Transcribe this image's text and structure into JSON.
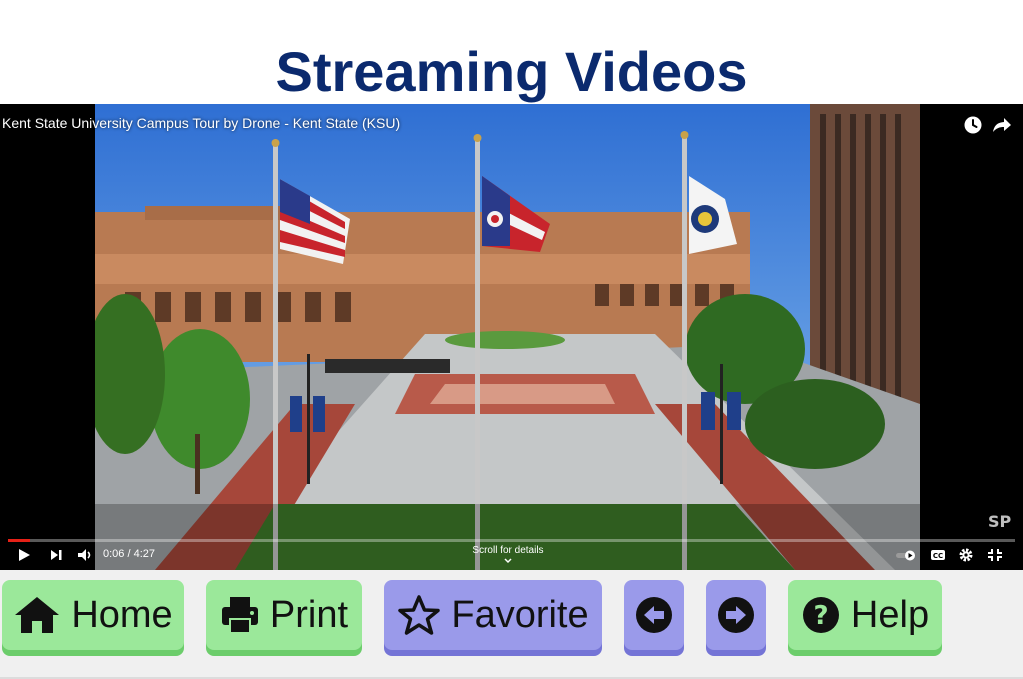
{
  "page": {
    "title": "Streaming Videos"
  },
  "video": {
    "title": "Kent State University Campus Tour by Drone - Kent State (KSU)",
    "current_time": "0:06",
    "duration": "4:27",
    "time_display": "0:06 / 4:27",
    "progress": 0.022,
    "scroll_hint": "Scroll for details",
    "watermark": "SP",
    "icons": [
      "watch-later-icon",
      "share-icon",
      "play-icon",
      "next-icon",
      "volume-icon",
      "autoplay-toggle-icon",
      "captions-icon",
      "settings-icon",
      "exit-fullscreen-icon"
    ]
  },
  "toolbar": {
    "home": "Home",
    "print": "Print",
    "favorite": "Favorite",
    "help": "Help",
    "colors": {
      "green": "#9be89a",
      "purple": "#9a9aea"
    }
  },
  "colors": {
    "title": "#0b2a6e",
    "progress": "#e62117"
  }
}
